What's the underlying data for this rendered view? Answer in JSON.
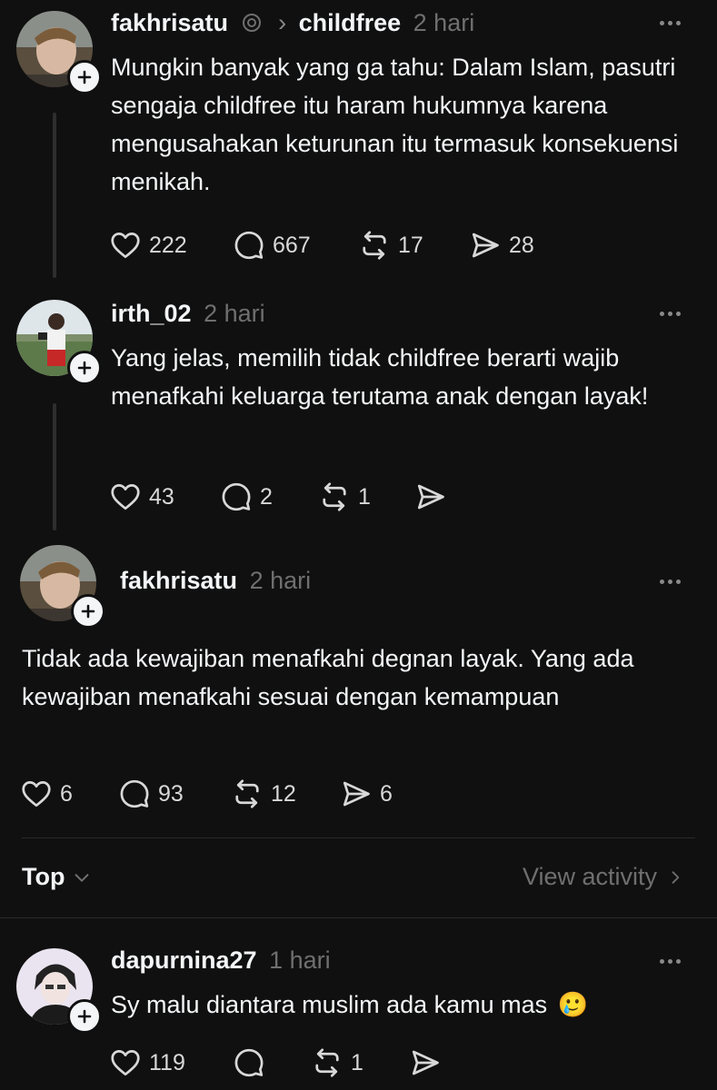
{
  "posts": [
    {
      "username": "fakhrisatu",
      "community": "childfree",
      "time": "2 hari",
      "text": "Mungkin banyak yang ga tahu: Dalam Islam, pasutri sengaja childfree itu haram hukumnya karena mengusahakan keturunan itu termasuk konsekuensi menikah.",
      "likes": "222",
      "replies": "667",
      "reposts": "17",
      "shares": "28"
    },
    {
      "username": "irth_02",
      "time": "2 hari",
      "text": "Yang jelas, memilih tidak childfree berarti wajib menafkahi keluarga terutama anak dengan layak!",
      "likes": "43",
      "replies": "2",
      "reposts": "1",
      "shares": ""
    },
    {
      "username": "fakhrisatu",
      "time": "2 hari",
      "text": "Tidak ada  kewajiban menafkahi degnan layak. Yang ada kewajiban menafkahi sesuai dengan kemampuan",
      "likes": "6",
      "replies": "93",
      "reposts": "12",
      "shares": "6"
    }
  ],
  "sort": {
    "label": "Top",
    "activity_label": "View activity"
  },
  "reply": {
    "username": "dapurnina27",
    "time": "1 hari",
    "text": "Sy malu diantara muslim ada kamu mas",
    "emoji": "🥲",
    "likes": "119",
    "replies": "",
    "reposts": "1",
    "shares": ""
  },
  "icons": [
    "heart-icon",
    "comment-icon",
    "repost-icon",
    "share-icon",
    "more-icon",
    "plus-icon",
    "chevron-down-icon",
    "chevron-right-icon",
    "threads-icon"
  ]
}
